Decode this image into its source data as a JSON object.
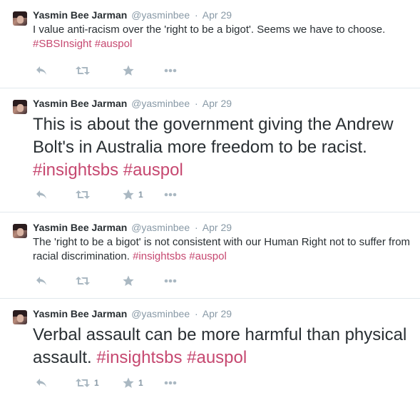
{
  "tweets": [
    {
      "fullname": "Yasmin Bee Jarman",
      "username": "@yasminbee",
      "time": "Apr 29",
      "text_parts": [
        "I value anti-racism over the 'right to be a bigot'. Seems we have to choose.",
        "#SBSInsight",
        "#auspol"
      ],
      "retweets": "",
      "favorites": ""
    },
    {
      "fullname": "Yasmin Bee Jarman",
      "username": "@yasminbee",
      "time": "Apr 29",
      "text_parts": [
        "This is about the government giving the Andrew Bolt's in Australia more freedom to be racist.",
        "#insightsbs",
        "#auspol"
      ],
      "retweets": "",
      "favorites": "1"
    },
    {
      "fullname": "Yasmin Bee Jarman",
      "username": "@yasminbee",
      "time": "Apr 29",
      "text_parts": [
        "The 'right to be a bigot' is not consistent with our Human Right not to suffer from racial discrimination.",
        "#insightsbs",
        "#auspol"
      ],
      "retweets": "",
      "favorites": ""
    },
    {
      "fullname": "Yasmin Bee Jarman",
      "username": "@yasminbee",
      "time": "Apr 29",
      "text_parts": [
        "Verbal assault can be more harmful than physical assault.",
        "#insightsbs",
        "#auspol"
      ],
      "retweets": "1",
      "favorites": "1"
    }
  ],
  "icons": {
    "reply": "reply-icon",
    "retweet": "retweet-icon",
    "favorite": "star-icon",
    "more": "more-icon"
  },
  "colors": {
    "hashtag": "#c64870",
    "icon": "#aab8c2",
    "meta": "#8899a6",
    "text": "#292f33",
    "divider": "#e1e8ed"
  }
}
